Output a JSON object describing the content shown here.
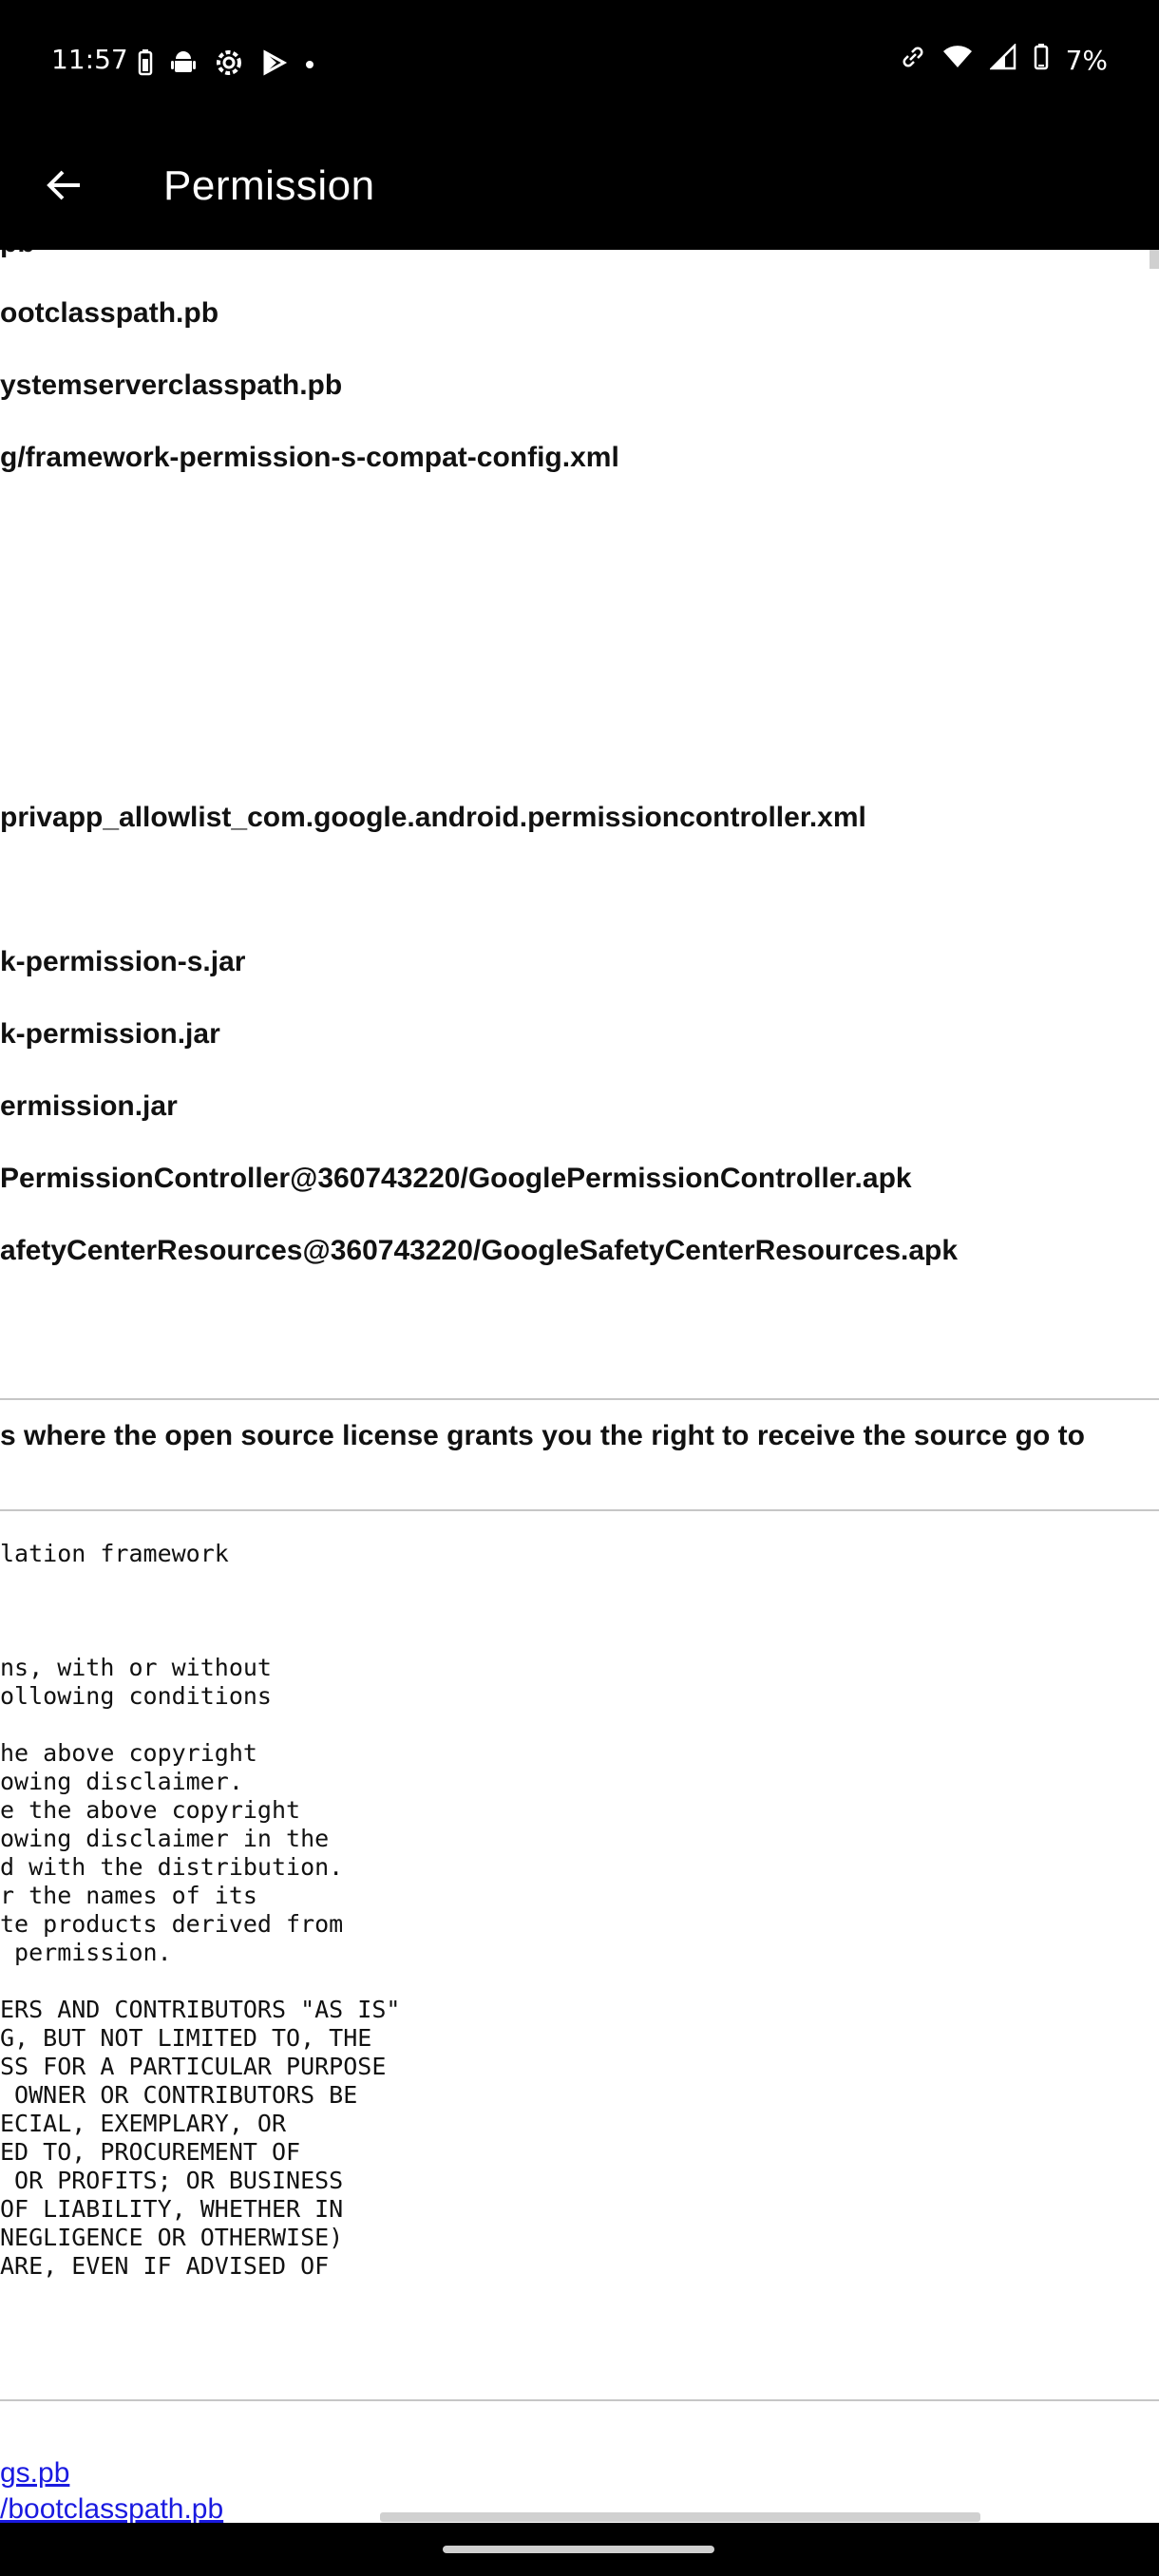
{
  "status_bar": {
    "time": "11:57",
    "battery_percent": "7%",
    "left_icons": [
      "battery-saver-icon",
      "android-icon",
      "settings-gear-icon",
      "play-store-icon",
      "dot-icon"
    ],
    "right_icons": [
      "link-icon",
      "wifi-icon",
      "signal-icon",
      "battery-icon"
    ]
  },
  "app_bar": {
    "title": "Permission",
    "back_icon": "arrow-back-icon"
  },
  "content": {
    "file_lines": [
      "pb",
      "ootclasspath.pb",
      "ystemserverclasspath.pb",
      "g/framework-permission-s-compat-config.xml",
      "privapp_allowlist_com.google.android.permissioncontroller.xml",
      "k-permission-s.jar",
      "k-permission.jar",
      "ermission.jar",
      "PermissionController@360743220/GooglePermissionController.apk",
      "afetyCenterResources@360743220/GoogleSafetyCenterResources.apk"
    ],
    "notice": "s where the open source license grants you the right to receive the source go to",
    "license_title": "lation framework",
    "license_block_1": "ns, with or without\nollowing conditions",
    "license_block_2": "he above copyright\nowing disclaimer.\ne the above copyright\nowing disclaimer in the\nd with the distribution.\nr the names of its\nte products derived from\n permission.",
    "license_block_3": "ERS AND CONTRIBUTORS \"AS IS\"\nG, BUT NOT LIMITED TO, THE\nSS FOR A PARTICULAR PURPOSE\n OWNER OR CONTRIBUTORS BE\nECIAL, EXEMPLARY, OR\nED TO, PROCUREMENT OF\n OR PROFITS; OR BUSINESS\nOF LIABILITY, WHETHER IN\nNEGLIGENCE OR OTHERWISE)\nARE, EVEN IF ADVISED OF",
    "links": [
      "gs.pb",
      "/bootclasspath.pb"
    ]
  }
}
